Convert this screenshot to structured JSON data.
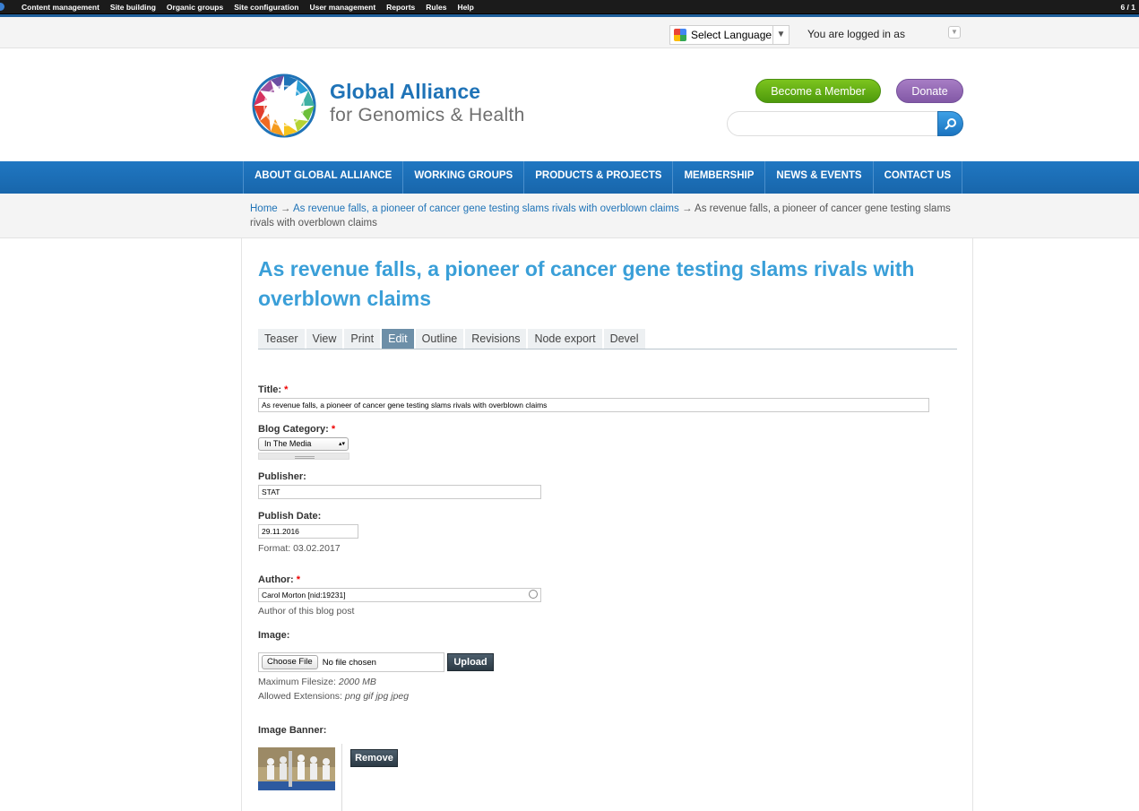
{
  "admin_bar": {
    "items": [
      "Content management",
      "Site building",
      "Organic groups",
      "Site configuration",
      "User management",
      "Reports",
      "Rules",
      "Help"
    ],
    "counter": "6 / 1"
  },
  "util_bar": {
    "language_label": "Select Language",
    "language_arrow": "▼",
    "logged_in_text": "You are logged in as"
  },
  "header": {
    "logo_title": "Global Alliance",
    "logo_subtitle": "for Genomics & Health",
    "become_member_label": "Become a Member",
    "donate_label": "Donate",
    "search_value": ""
  },
  "nav": {
    "items": [
      "ABOUT GLOBAL ALLIANCE",
      "WORKING GROUPS",
      "PRODUCTS & PROJECTS",
      "MEMBERSHIP",
      "NEWS & EVENTS",
      "CONTACT US"
    ]
  },
  "breadcrumb": {
    "home": "Home",
    "sep": " → ",
    "parent": "As revenue falls, a pioneer of cancer gene testing slams rivals with overblown claims",
    "current": "As revenue falls, a pioneer of cancer gene testing slams rivals with overblown claims"
  },
  "page": {
    "title": "As revenue falls, a pioneer of cancer gene testing slams rivals with overblown claims"
  },
  "tabs": [
    {
      "label": "Teaser"
    },
    {
      "label": "View"
    },
    {
      "label": "Print"
    },
    {
      "label": "Edit"
    },
    {
      "label": "Outline"
    },
    {
      "label": "Revisions"
    },
    {
      "label": "Node export"
    },
    {
      "label": "Devel"
    }
  ],
  "form": {
    "required_mark": "*",
    "title_label": "Title:",
    "title_value": "As revenue falls, a pioneer of cancer gene testing slams rivals with overblown claims",
    "category_label": "Blog Category:",
    "category_value": "In The Media",
    "publisher_label": "Publisher:",
    "publisher_value": "STAT",
    "date_label": "Publish Date:",
    "date_value": "29.11.2016",
    "date_format": "Format: 03.02.2017",
    "author_label": "Author:",
    "author_value": "Carol Morton [nid:19231]",
    "author_help": "Author of this blog post",
    "image_label": "Image:",
    "choose_file_label": "Choose File",
    "no_file_text": "No file chosen",
    "upload_label": "Upload",
    "max_filesize_prefix": "Maximum Filesize:",
    "max_filesize_value": "2000 MB",
    "allowed_ext_prefix": "Allowed Extensions:",
    "allowed_ext_value": "png gif jpg jpeg",
    "banner_label": "Image Banner:",
    "remove_label": "Remove"
  },
  "colors": {
    "brand_blue": "#1f73b7",
    "title_blue": "#3a9fd8",
    "nav_blue": "#1866ab",
    "member_green": "#5fae14",
    "donate_purple": "#8e64b0",
    "active_tab": "#6d8fa8",
    "required_red": "#e00000"
  }
}
